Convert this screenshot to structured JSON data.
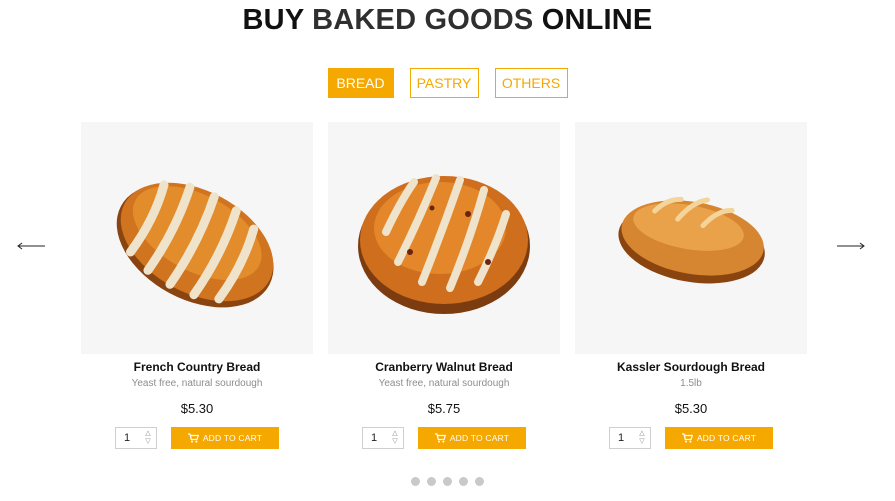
{
  "header": {
    "title_part1": "BUY ",
    "title_part2": "BAKED GOODS",
    "title_part3": " ONLINE"
  },
  "tabs": [
    {
      "label": "BREAD",
      "active": true
    },
    {
      "label": "PASTRY",
      "active": false
    },
    {
      "label": "OTHERS",
      "active": false
    }
  ],
  "carousel": {
    "prev_icon": "arrow-left-icon",
    "next_icon": "arrow-right-icon",
    "dot_count": 5
  },
  "products": [
    {
      "name": "French Country Bread",
      "description": "Yeast free, natural sourdough",
      "price": "$5.30",
      "quantity": "1",
      "cart_label": "ADD TO CART"
    },
    {
      "name": "Cranberry Walnut Bread",
      "description": "Yeast free, natural sourdough",
      "price": "$5.75",
      "quantity": "1",
      "cart_label": "ADD TO CART"
    },
    {
      "name": "Kassler Sourdough Bread",
      "description": "1.5lb",
      "price": "$5.30",
      "quantity": "1",
      "cart_label": "ADD TO CART"
    }
  ],
  "colors": {
    "accent": "#f5a800",
    "image_bg": "#f6f6f6",
    "muted_text": "#8d8d8d"
  }
}
